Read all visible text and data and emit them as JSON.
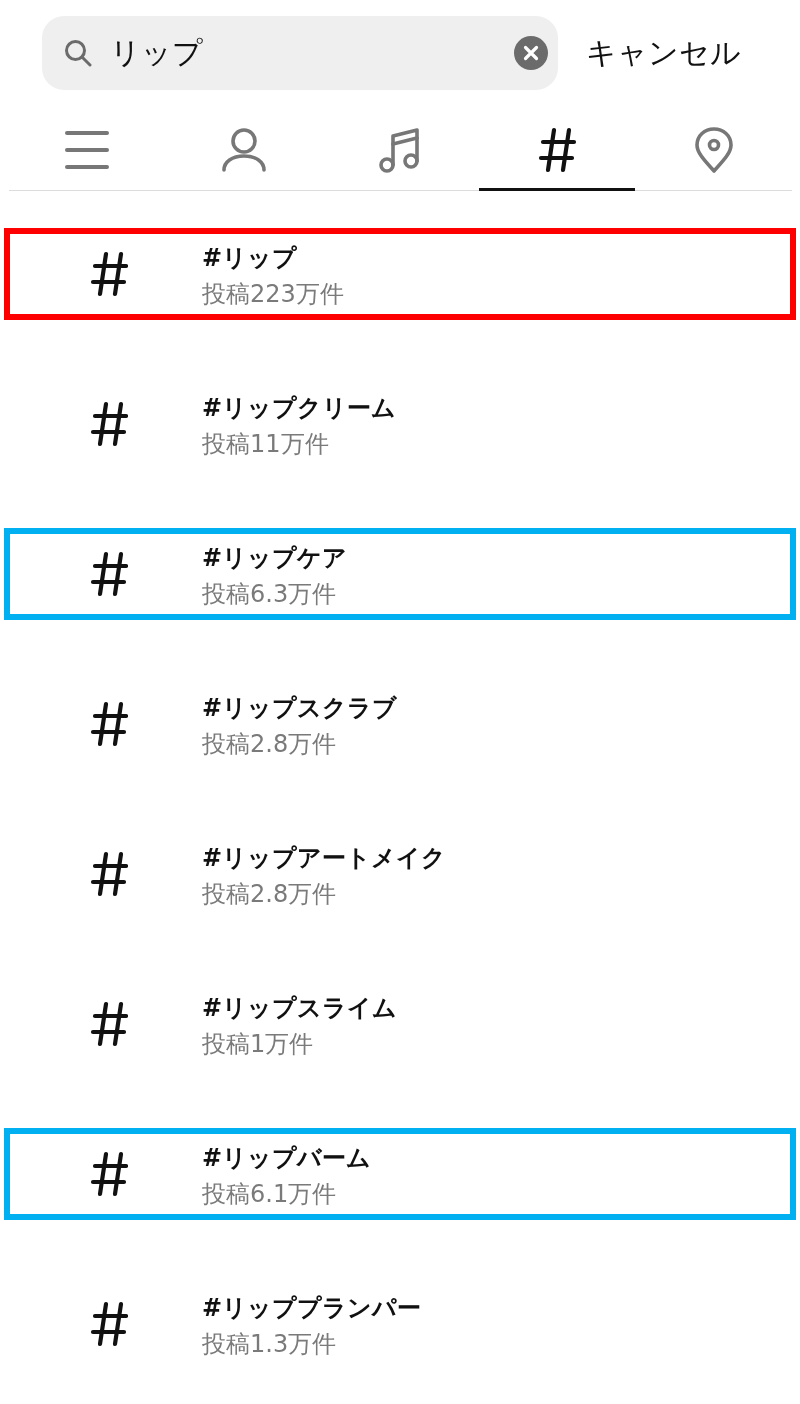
{
  "search": {
    "value": "リップ",
    "cancel": "キャンセル"
  },
  "tabs": [
    {
      "kind": "menu",
      "selected": false
    },
    {
      "kind": "person",
      "selected": false
    },
    {
      "kind": "music",
      "selected": false
    },
    {
      "kind": "hashtag",
      "selected": true
    },
    {
      "kind": "location",
      "selected": false
    }
  ],
  "results": [
    {
      "tag": "#リップ",
      "posts": "投稿223万件",
      "color": "#ff0000"
    },
    {
      "tag": "#リップクリーム",
      "posts": "投稿11万件"
    },
    {
      "tag": "#リップケア",
      "posts": "投稿6.3万件",
      "color": "#00b0f0"
    },
    {
      "tag": "#リップスクラブ",
      "posts": "投稿2.8万件"
    },
    {
      "tag": "#リップアートメイク",
      "posts": "投稿2.8万件"
    },
    {
      "tag": "#リップスライム",
      "posts": "投稿1万件"
    },
    {
      "tag": "#リップバーム",
      "posts": "投稿6.1万件",
      "color": "#00b0f0"
    },
    {
      "tag": "#リッププランパー",
      "posts": "投稿1.3万件"
    }
  ]
}
